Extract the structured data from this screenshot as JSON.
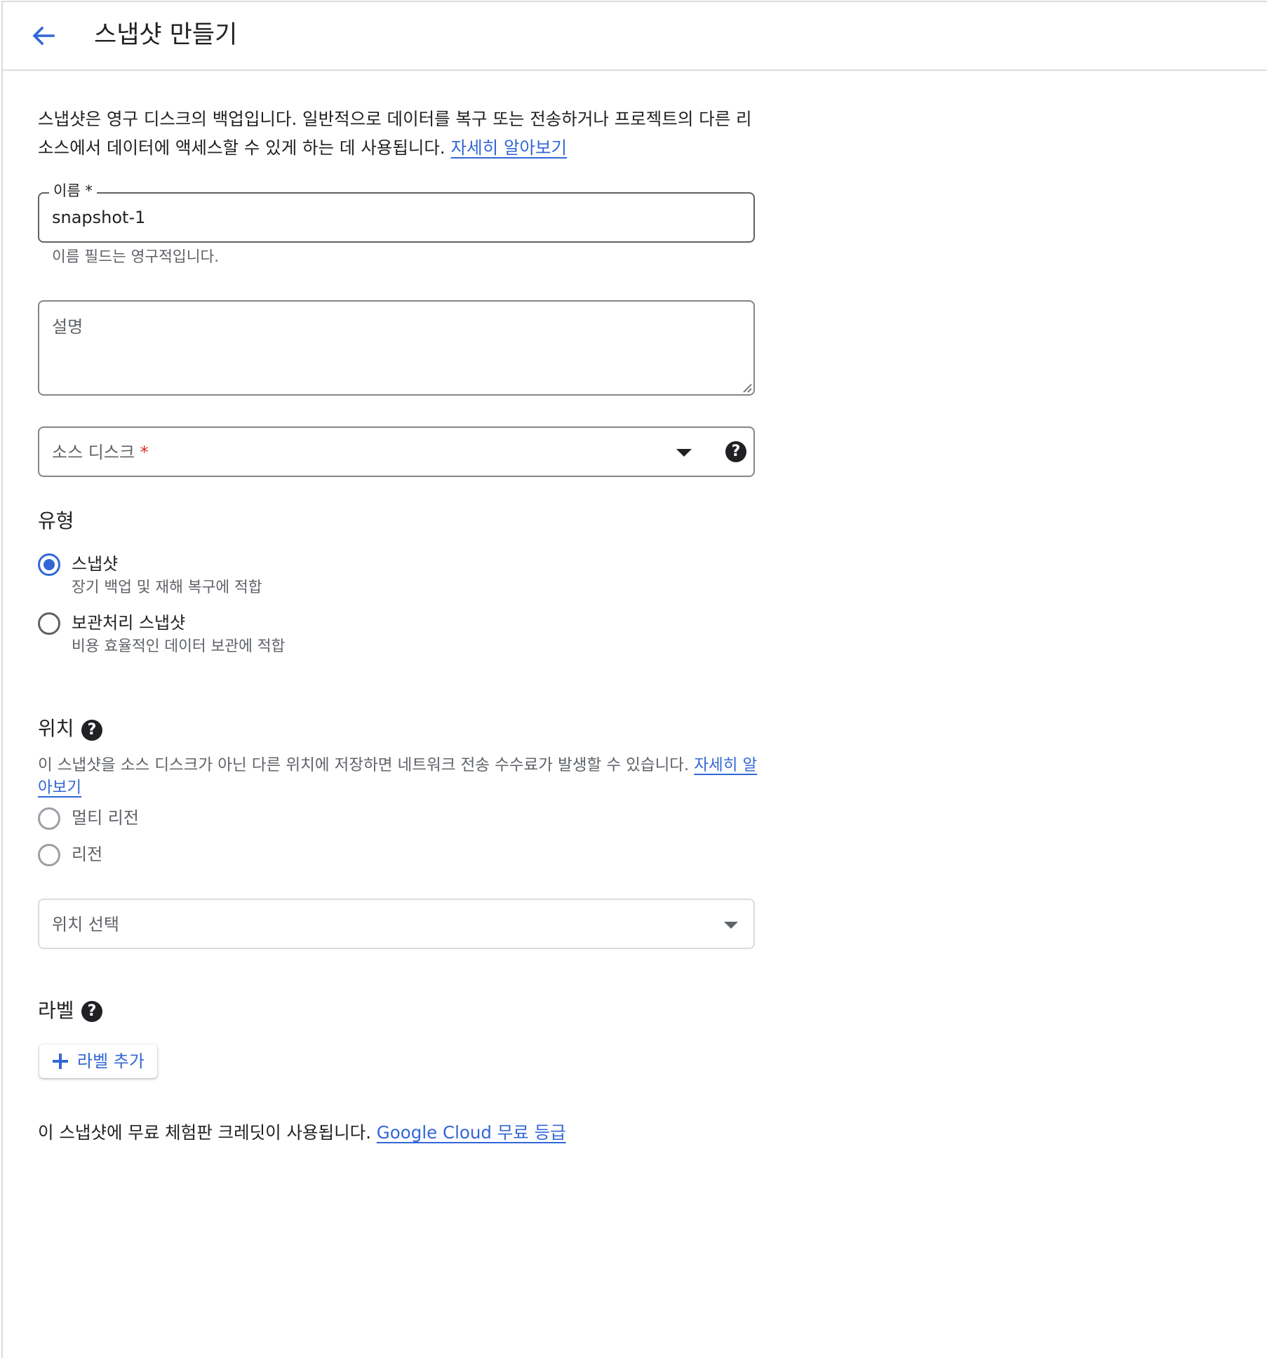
{
  "header": {
    "title": "스냅샷 만들기",
    "back_icon": "arrow-back-icon"
  },
  "intro": {
    "text": "스냅샷은 영구 디스크의 백업입니다. 일반적으로 데이터를 복구 또는 전송하거나 프로젝트의 다른 리소스에서 데이터에 액세스할 수 있게 하는 데 사용됩니다.",
    "link": "자세히 알아보기"
  },
  "name_field": {
    "label": "이름 *",
    "value": "snapshot-1",
    "helper": "이름 필드는 영구적입니다."
  },
  "description_field": {
    "placeholder": "설명",
    "value": ""
  },
  "source_disk": {
    "label": "소스 디스크",
    "required_mark": "*",
    "help_icon": "help-icon"
  },
  "type_section": {
    "title": "유형",
    "options": [
      {
        "label": "스냅샷",
        "sub": "장기 백업 및 재해 복구에 적합",
        "checked": true
      },
      {
        "label": "보관처리 스냅샷",
        "sub": "비용 효율적인 데이터 보관에 적합",
        "checked": false
      }
    ]
  },
  "location_section": {
    "title": "위치",
    "help_icon": "help-icon",
    "description": "이 스냅샷을 소스 디스크가 아닌 다른 위치에 저장하면 네트워크 전송 수수료가 발생할 수 있습니다.",
    "link": "자세히 알아보기",
    "options": [
      {
        "label": "멀티 리전",
        "checked": false
      },
      {
        "label": "리전",
        "checked": false
      }
    ],
    "select_placeholder": "위치 선택"
  },
  "labels_section": {
    "title": "라벨",
    "help_icon": "help-icon",
    "add_button": "라벨 추가"
  },
  "footer": {
    "credit_text": "이 스냅샷에 무료 체험판 크레딧이 사용됩니다.",
    "credit_link": "Google Cloud 무료 등급"
  },
  "colors": {
    "accent": "#3367d6",
    "required": "#d93025",
    "border": "#80868b",
    "divider": "#dadce0"
  }
}
